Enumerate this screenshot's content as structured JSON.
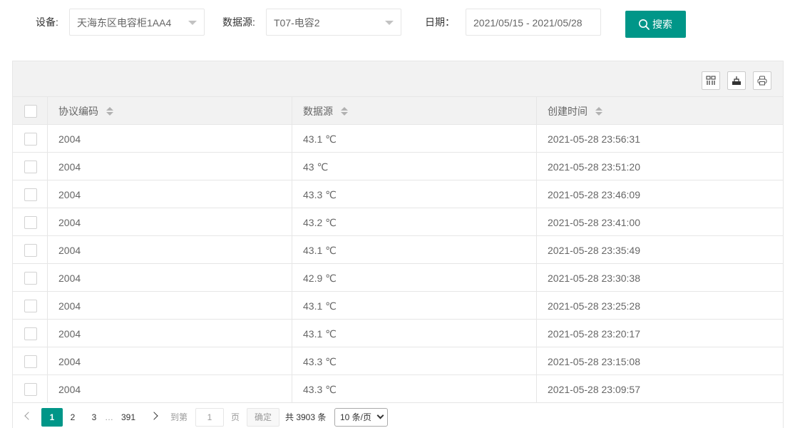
{
  "filters": {
    "device_label": "设备:",
    "device_value": "天海东区电容柜1AA4",
    "source_label": "数据源:",
    "source_value": "T07-电容2",
    "date_label": "日期：",
    "date_value": "2021/05/15 - 2021/05/28",
    "search_label": "搜索"
  },
  "toolbar": {
    "icons": [
      "columns-filter-icon",
      "export-icon",
      "print-icon"
    ]
  },
  "table": {
    "columns": [
      "协议编码",
      "数据源",
      "创建时间"
    ],
    "rows": [
      {
        "code": "2004",
        "value": "43.1 ℃",
        "time": "2021-05-28 23:56:31"
      },
      {
        "code": "2004",
        "value": "43 ℃",
        "time": "2021-05-28 23:51:20"
      },
      {
        "code": "2004",
        "value": "43.3 ℃",
        "time": "2021-05-28 23:46:09"
      },
      {
        "code": "2004",
        "value": "43.2 ℃",
        "time": "2021-05-28 23:41:00"
      },
      {
        "code": "2004",
        "value": "43.1 ℃",
        "time": "2021-05-28 23:35:49"
      },
      {
        "code": "2004",
        "value": "42.9 ℃",
        "time": "2021-05-28 23:30:38"
      },
      {
        "code": "2004",
        "value": "43.1 ℃",
        "time": "2021-05-28 23:25:28"
      },
      {
        "code": "2004",
        "value": "43.1 ℃",
        "time": "2021-05-28 23:20:17"
      },
      {
        "code": "2004",
        "value": "43.3 ℃",
        "time": "2021-05-28 23:15:08"
      },
      {
        "code": "2004",
        "value": "43.3 ℃",
        "time": "2021-05-28 23:09:57"
      }
    ]
  },
  "pager": {
    "page1": "1",
    "page2": "2",
    "page3": "3",
    "ellipsis": "…",
    "last_page": "391",
    "goto_label": "到第",
    "goto_value": "1",
    "page_unit": "页",
    "confirm_label": "确定",
    "total_text": "共 3903 条",
    "page_size": "10 条/页"
  },
  "colors": {
    "accent": "#009688",
    "header_bg": "#f2f2f2",
    "border": "#e6e6e6"
  }
}
